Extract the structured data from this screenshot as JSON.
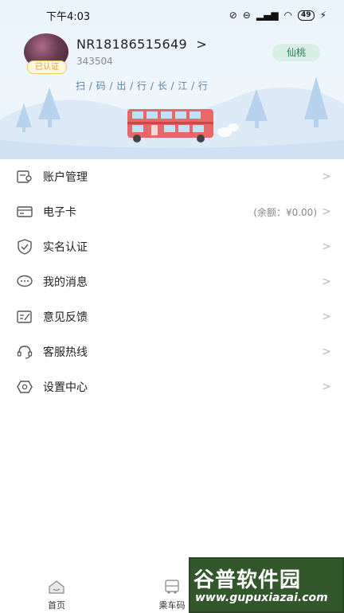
{
  "status_bar": {
    "time": "下午4:03",
    "battery": "49"
  },
  "profile": {
    "username": "NR18186515649",
    "username_arrow": ">",
    "user_id": "343504",
    "verified_label": "已认证",
    "tag_label": "仙桃",
    "slogan": "扫 / 码 / 出 / 行 / 长 / 江 / 行"
  },
  "menu": {
    "items": [
      {
        "label": "账户管理",
        "icon": "account-icon"
      },
      {
        "label": "电子卡",
        "icon": "card-icon",
        "extra": "(余额：¥0.00)"
      },
      {
        "label": "实名认证",
        "icon": "shield-check-icon"
      },
      {
        "label": "我的消息",
        "icon": "message-icon"
      },
      {
        "label": "意见反馈",
        "icon": "feedback-icon"
      },
      {
        "label": "客服热线",
        "icon": "headset-icon"
      },
      {
        "label": "设置中心",
        "icon": "settings-icon"
      }
    ],
    "chevron": ">"
  },
  "tabbar": {
    "tabs": [
      {
        "label": "首页",
        "icon": "home-icon"
      },
      {
        "label": "乘车码",
        "icon": "bus-icon"
      }
    ]
  },
  "watermark": {
    "title": "谷普软件园",
    "url": "www.gupuxiazai.com"
  },
  "colors": {
    "accent_green": "#2b7d60",
    "bus_red": "#e8686a",
    "sky": "#eaf4fb"
  }
}
